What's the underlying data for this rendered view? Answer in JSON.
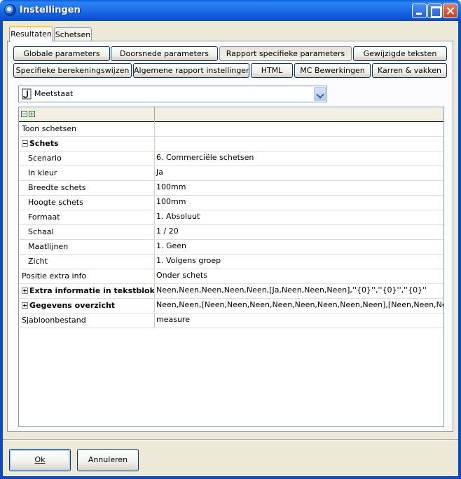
{
  "window": {
    "title": "Instellingen"
  },
  "outer_tabs": [
    {
      "label": "Resultaten"
    },
    {
      "label": "Schetsen"
    }
  ],
  "sub_tabs_row1": [
    {
      "label": "Globale parameters"
    },
    {
      "label": "Doorsnede parameters"
    },
    {
      "label": "Rapport specifieke parameters"
    },
    {
      "label": "Gewijzigde teksten"
    }
  ],
  "sub_tabs_row2": [
    {
      "label": "Specifieke berekeningswijzen"
    },
    {
      "label": "Algemene rapport instellingen"
    },
    {
      "label": "HTML"
    },
    {
      "label": "MC Bewerkingen"
    },
    {
      "label": "Karren & vakken"
    }
  ],
  "report_select": {
    "value": "Meetstaat",
    "icon": "report-icon"
  },
  "grid": {
    "rows": [
      {
        "name": "Toon schetsen",
        "value": ""
      },
      {
        "name": "Schets",
        "value": ""
      },
      {
        "name": "Scenario",
        "value": "6. Commerciële schetsen"
      },
      {
        "name": "In kleur",
        "value": "Ja"
      },
      {
        "name": "Breedte schets",
        "value": "100mm"
      },
      {
        "name": "Hoogte schets",
        "value": "100mm"
      },
      {
        "name": "Formaat",
        "value": "1. Absoluut"
      },
      {
        "name": "Schaal",
        "value": "1 / 20"
      },
      {
        "name": "Maatlijnen",
        "value": "1. Geen"
      },
      {
        "name": "Zicht",
        "value": "1. Volgens groep"
      },
      {
        "name": "Positie extra info",
        "value": "Onder schets"
      },
      {
        "name": "Extra informatie in tekstblok",
        "value": "Neen,Neen,Neen,Neen,Neen,[Ja,Neen,Neen,Neen],''{0}'',''{0}'',''{0}''"
      },
      {
        "name": "Gegevens overzicht",
        "value": "Neen,Neen,[Neen,Neen,Neen,Neen,Neen,Neen,Neen,Neen],[Neen,Neen,Neen,Neen"
      },
      {
        "name": "Sjabloonbestand",
        "value": "measure"
      }
    ]
  },
  "buttons": {
    "ok": "Ok",
    "cancel": "Annuleren"
  }
}
